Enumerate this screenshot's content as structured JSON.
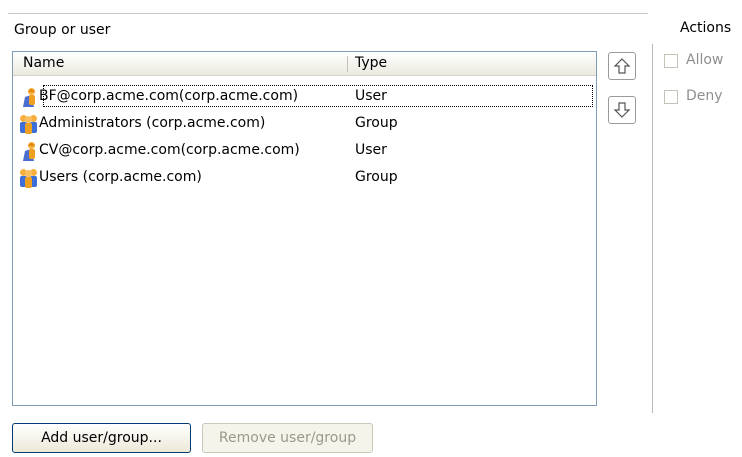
{
  "panel": {
    "group_label": "Group or user",
    "actions_label": "Actions"
  },
  "list": {
    "columns": {
      "name": "Name",
      "type": "Type"
    },
    "rows": [
      {
        "name": "BF@corp.acme.com(corp.acme.com)",
        "type": "User",
        "icon": "user-icon",
        "selected": true
      },
      {
        "name": "Administrators (corp.acme.com)",
        "type": "Group",
        "icon": "group-icon",
        "selected": false
      },
      {
        "name": "CV@corp.acme.com(corp.acme.com)",
        "type": "User",
        "icon": "user-icon",
        "selected": false
      },
      {
        "name": "Users  (corp.acme.com)",
        "type": "Group",
        "icon": "group-icon",
        "selected": false
      }
    ]
  },
  "buttons": {
    "add": "Add user/group...",
    "remove": "Remove user/group"
  },
  "actions": {
    "allow": "Allow",
    "deny": "Deny"
  },
  "colors": {
    "list_border": "#7f9db9",
    "button_border": "#003c74",
    "disabled_text": "#9a9a8a"
  }
}
